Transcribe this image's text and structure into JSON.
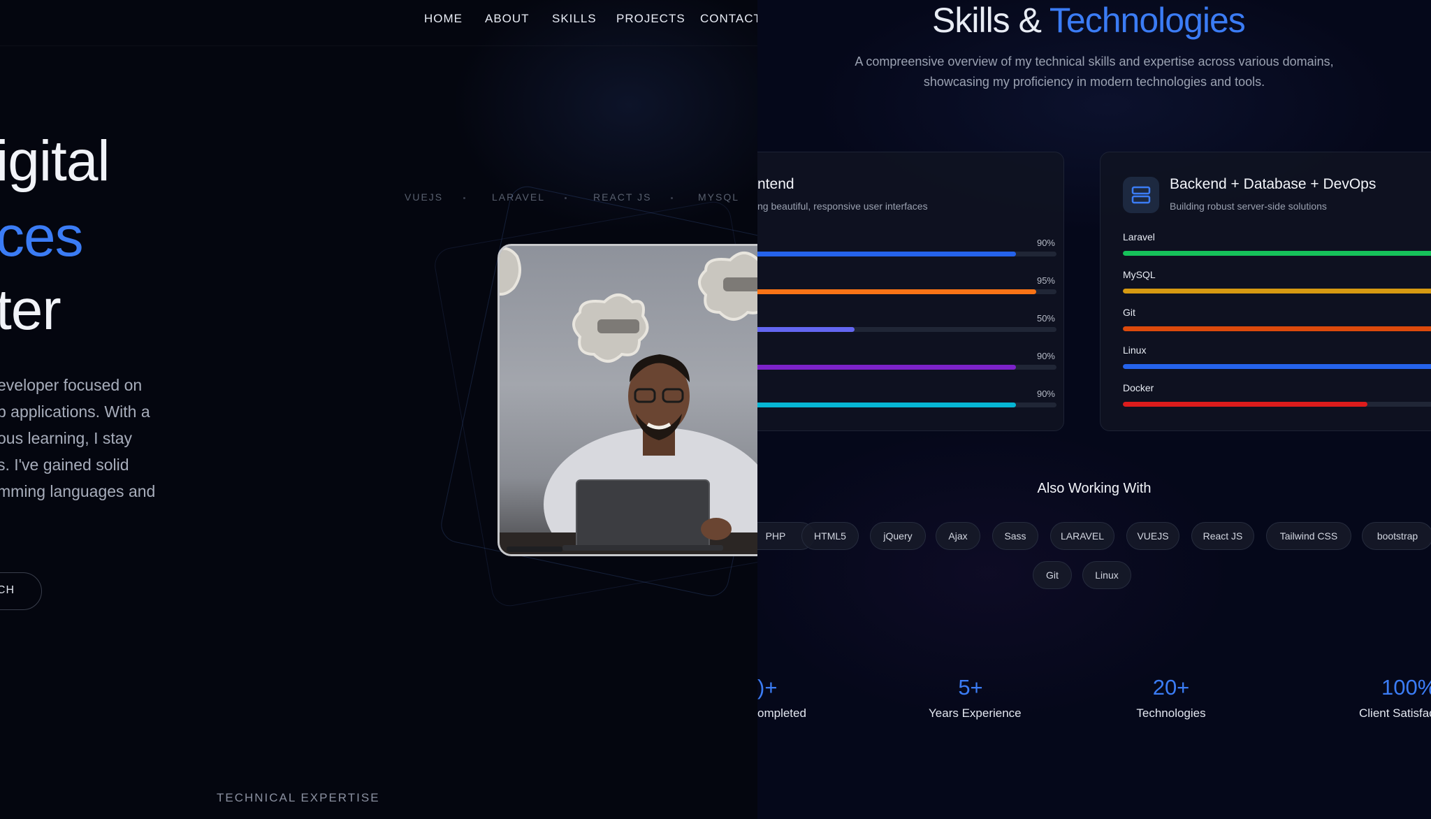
{
  "nav": {
    "items": [
      "HOME",
      "ABOUT",
      "SKILLS",
      "PROJECTS",
      "CONTACT"
    ]
  },
  "hero": {
    "title_lines": [
      "igital",
      "ces",
      "ter"
    ],
    "description_lines": [
      "eveloper focused on",
      "b applications. With a",
      "ous learning, I stay",
      "s. I've gained solid",
      "mming languages and"
    ],
    "button_label": "CH",
    "tech_tags": [
      "VUEJS",
      "LARAVEL",
      "REACT JS",
      "MYSQL"
    ],
    "section_label": "TECHNICAL EXPERTISE"
  },
  "skills": {
    "title_part1": "Skills &",
    "title_part2": "Technologies",
    "subtitle_lines": [
      "A compreensive overview of my technical skills and expertise across various domains,",
      "showcasing my proficiency in modern technologies and tools."
    ],
    "frontend_card": {
      "title": "ntend",
      "subtitle": "ng beautiful, responsive user interfaces",
      "skills": [
        {
          "label": "",
          "percent": "90%",
          "value": 0.9,
          "color": "#2563eb"
        },
        {
          "label": "",
          "percent": "95%",
          "value": 0.95,
          "color": "#f97316"
        },
        {
          "label": "",
          "percent": "50%",
          "value": 0.5,
          "color": "#6366f1"
        },
        {
          "label": "",
          "percent": "90%",
          "value": 0.9,
          "color": "#7c22c9"
        },
        {
          "label": "",
          "percent": "90%",
          "value": 0.9,
          "color": "#06b6d4"
        }
      ]
    },
    "backend_card": {
      "title": "Backend + Database + DevOps",
      "subtitle": "Building robust server-side solutions",
      "icon": "server-icon",
      "skills": [
        {
          "label": "Laravel",
          "value": 1.0,
          "color": "#16c25a"
        },
        {
          "label": "MySQL",
          "value": 1.0,
          "color": "#d69a12"
        },
        {
          "label": "Git",
          "value": 1.0,
          "color": "#dc4a0c"
        },
        {
          "label": "Linux",
          "value": 0.93,
          "color": "#2563eb"
        },
        {
          "label": "Docker",
          "value": 0.7,
          "color": "#dc1c1c"
        }
      ]
    },
    "also_title": "Also Working With",
    "pills_row1": [
      "PHP",
      "HTML5",
      "jQuery",
      "Ajax",
      "Sass",
      "LARAVEL",
      "VUEJS",
      "React JS",
      "Tailwind CSS",
      "bootstrap"
    ],
    "pills_row2": [
      "Git",
      "Linux"
    ],
    "stats": [
      {
        "value": ")+",
        "label": "ompleted"
      },
      {
        "value": "5+",
        "label": "Years Experience"
      },
      {
        "value": "20+",
        "label": "Technologies"
      },
      {
        "value": "100%",
        "label": "Client Satisfac"
      }
    ]
  },
  "colors": {
    "accent": "#3b7cf5",
    "background": "#04060f"
  }
}
